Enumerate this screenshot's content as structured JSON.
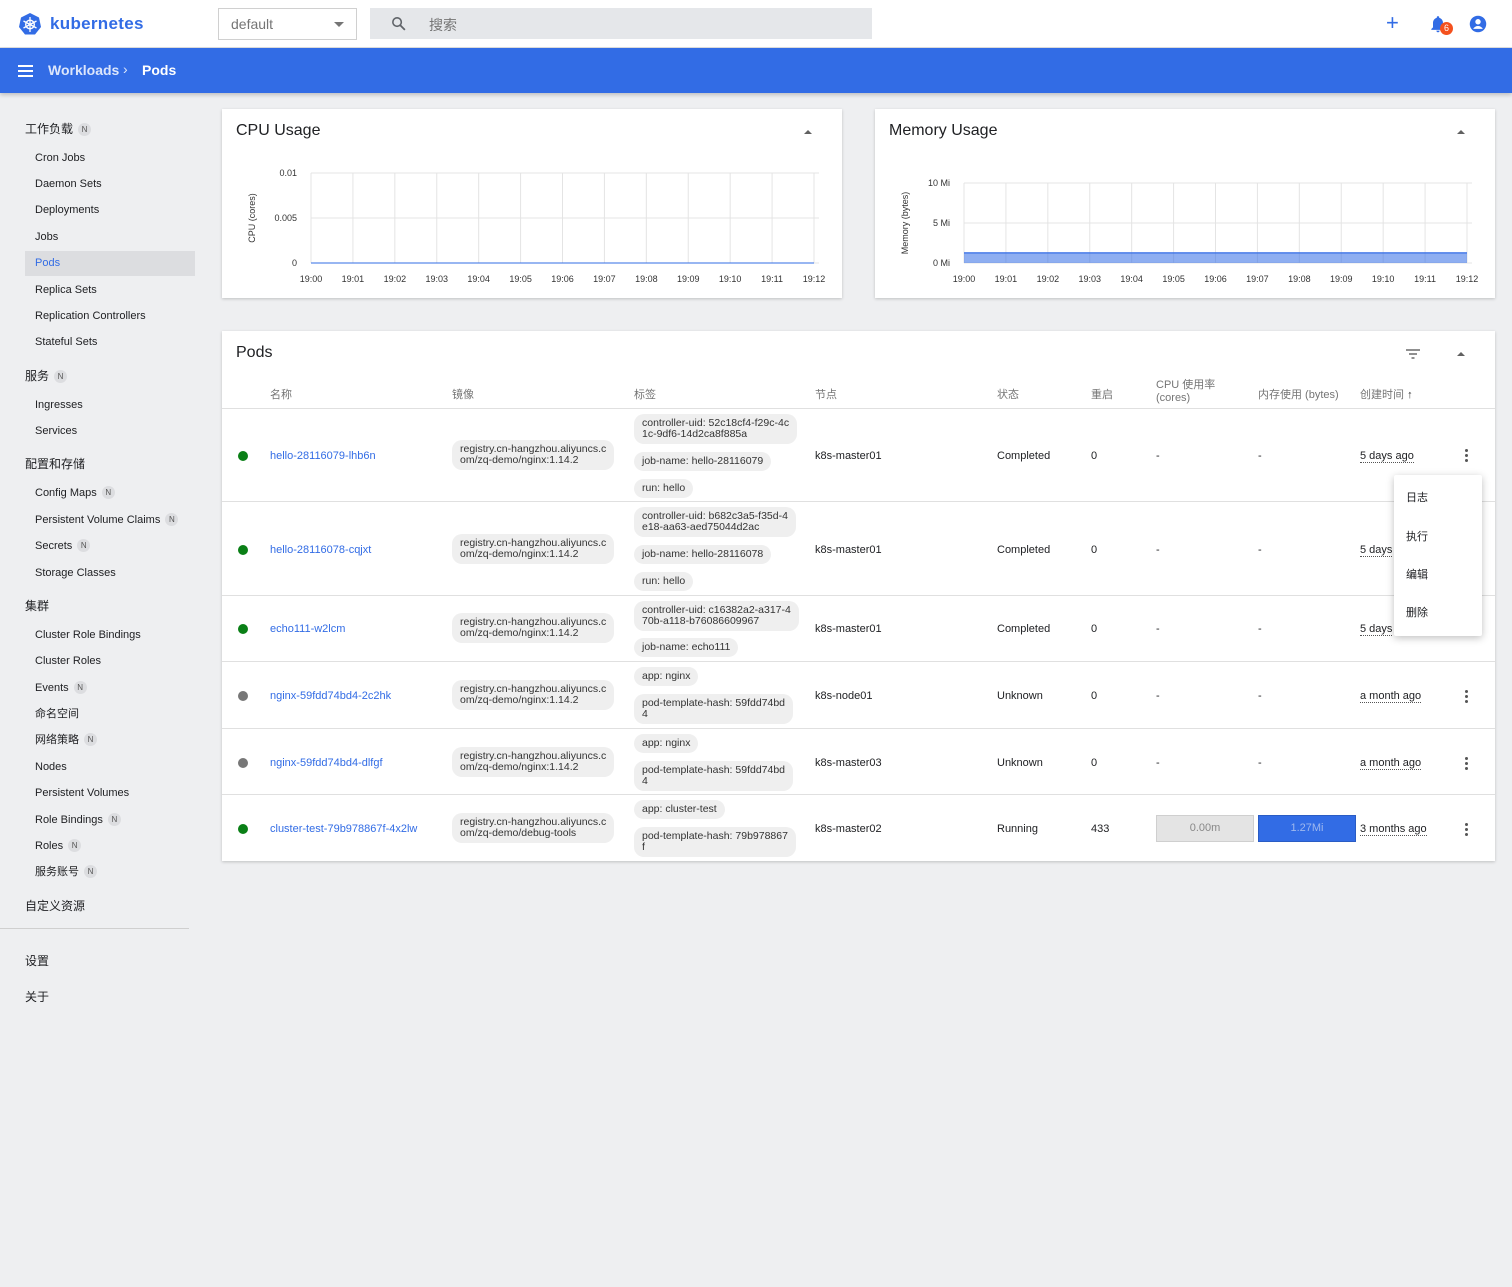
{
  "app": {
    "name": "kubernetes"
  },
  "topbar": {
    "namespace": "default",
    "search_placeholder": "搜索",
    "notification_count": "6"
  },
  "breadcrumb": {
    "parent": "Workloads",
    "current": "Pods"
  },
  "sidebar": {
    "workloads_label": "工作负载",
    "workload_items": [
      "Cron Jobs",
      "Daemon Sets",
      "Deployments",
      "Jobs",
      "Pods",
      "Replica Sets",
      "Replication Controllers",
      "Stateful Sets"
    ],
    "services_label": "服务",
    "service_items": [
      "Ingresses",
      "Services"
    ],
    "config_label": "配置和存储",
    "config_items": [
      "Config Maps",
      "Persistent Volume Claims",
      "Secrets",
      "Storage Classes"
    ],
    "cluster_label": "集群",
    "cluster_items": [
      "Cluster Role Bindings",
      "Cluster Roles",
      "Events",
      "命名空间",
      "网络策略",
      "Nodes",
      "Persistent Volumes",
      "Role Bindings",
      "Roles",
      "服务账号"
    ],
    "crd_label": "自定义资源",
    "settings_label": "设置",
    "about_label": "关于",
    "badge": "N"
  },
  "cpu_card": {
    "title": "CPU Usage"
  },
  "memory_card": {
    "title": "Memory Usage"
  },
  "chart_data": [
    {
      "type": "line",
      "title": "CPU Usage",
      "ylabel": "CPU (cores)",
      "x": [
        "19:00",
        "19:01",
        "19:02",
        "19:03",
        "19:04",
        "19:05",
        "19:06",
        "19:07",
        "19:08",
        "19:09",
        "19:10",
        "19:11",
        "19:12"
      ],
      "ytick_labels": [
        "0",
        "0.005",
        "0.01"
      ],
      "ylim": [
        0,
        0.01
      ],
      "series": [
        {
          "values": [
            0,
            0,
            0,
            0,
            0,
            0,
            0,
            0,
            0,
            0,
            0,
            0,
            0
          ]
        }
      ],
      "grid": true
    },
    {
      "type": "area",
      "title": "Memory Usage",
      "ylabel": "Memory (bytes)",
      "x": [
        "19:00",
        "19:01",
        "19:02",
        "19:03",
        "19:04",
        "19:05",
        "19:06",
        "19:07",
        "19:08",
        "19:09",
        "19:10",
        "19:11",
        "19:12"
      ],
      "ytick_labels": [
        "0 Mi",
        "5 Mi",
        "10 Mi"
      ],
      "ylim": [
        0,
        10
      ],
      "series": [
        {
          "values": [
            1.27,
            1.27,
            1.27,
            1.27,
            1.27,
            1.27,
            1.27,
            1.27,
            1.27,
            1.27,
            1.27,
            1.27,
            1.27
          ]
        }
      ],
      "grid": true,
      "color": "#326ce5"
    }
  ],
  "pods": {
    "title": "Pods",
    "headers": {
      "name": "名称",
      "image": "镜像",
      "labels": "标签",
      "node": "节点",
      "status": "状态",
      "restarts": "重启",
      "cpu": "CPU 使用率\n(cores)",
      "memory": "内存使用 (bytes)",
      "created": "创建时间"
    },
    "rows": [
      {
        "name": "hello-28116079-lhb6n",
        "image": "registry.cn-hangzhou.aliyuncs.c\nom/zq-demo/nginx:1.14.2",
        "labels": [
          "controller-uid: 52c18cf4-f29c-4c\n1c-9df6-14d2ca8f885a",
          "job-name: hello-28116079",
          "run: hello"
        ],
        "node": "k8s-master01",
        "status": "Completed",
        "restarts": "0",
        "cpu": "-",
        "memory": "-",
        "age": "5 days ago",
        "status_color": "#0a7f16"
      },
      {
        "name": "hello-28116078-cqjxt",
        "image": "registry.cn-hangzhou.aliyuncs.c\nom/zq-demo/nginx:1.14.2",
        "labels": [
          "controller-uid: b682c3a5-f35d-4\ne18-aa63-aed75044d2ac",
          "job-name: hello-28116078",
          "run: hello"
        ],
        "node": "k8s-master01",
        "status": "Completed",
        "restarts": "0",
        "cpu": "-",
        "memory": "-",
        "age": "5 days",
        "status_color": "#0a7f16"
      },
      {
        "name": "echo111-w2lcm",
        "image": "registry.cn-hangzhou.aliyuncs.c\nom/zq-demo/nginx:1.14.2",
        "labels": [
          "controller-uid: c16382a2-a317-4\n70b-a118-b76086609967",
          "job-name: echo111"
        ],
        "node": "k8s-master01",
        "status": "Completed",
        "restarts": "0",
        "cpu": "-",
        "memory": "-",
        "age": "5 days",
        "status_color": "#0a7f16"
      },
      {
        "name": "nginx-59fdd74bd4-2c2hk",
        "image": "registry.cn-hangzhou.aliyuncs.c\nom/zq-demo/nginx:1.14.2",
        "labels": [
          "app: nginx",
          "pod-template-hash: 59fdd74bd\n4"
        ],
        "node": "k8s-node01",
        "status": "Unknown",
        "restarts": "0",
        "cpu": "-",
        "memory": "-",
        "age": "a month ago",
        "status_color": "#777777"
      },
      {
        "name": "nginx-59fdd74bd4-dlfgf",
        "image": "registry.cn-hangzhou.aliyuncs.c\nom/zq-demo/nginx:1.14.2",
        "labels": [
          "app: nginx",
          "pod-template-hash: 59fdd74bd\n4"
        ],
        "node": "k8s-master03",
        "status": "Unknown",
        "restarts": "0",
        "cpu": "-",
        "memory": "-",
        "age": "a month ago",
        "status_color": "#777777"
      },
      {
        "name": "cluster-test-79b978867f-4x2lw",
        "image": "registry.cn-hangzhou.aliyuncs.c\nom/zq-demo/debug-tools",
        "labels": [
          "app: cluster-test",
          "pod-template-hash: 79b978867\nf"
        ],
        "node": "k8s-master02",
        "status": "Running",
        "restarts": "433",
        "cpu": "0.00m",
        "memory": "1.27Mi",
        "age": "3 months ago",
        "status_color": "#0a7f16"
      }
    ]
  },
  "context_menu": {
    "items": [
      "日志",
      "执行",
      "编辑",
      "删除"
    ]
  }
}
